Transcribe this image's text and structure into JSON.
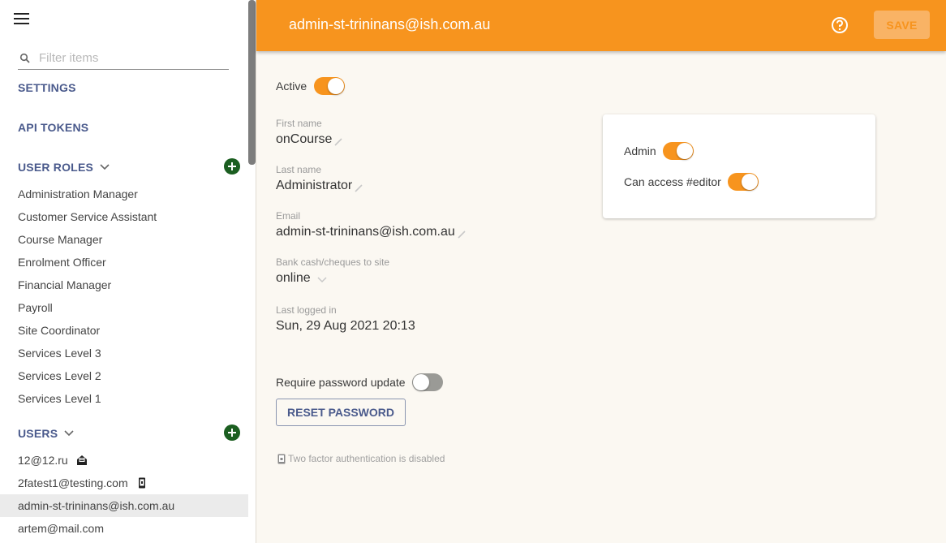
{
  "sidebar": {
    "filter_placeholder": "Filter items",
    "filter_value": "",
    "settings_label": "SETTINGS",
    "api_tokens_label": "API TOKENS",
    "user_roles": {
      "label": "USER ROLES",
      "items": [
        "Administration Manager",
        "Customer Service Assistant",
        "Course Manager",
        "Enrolment Officer",
        "Financial Manager",
        "Payroll",
        "Site Coordinator",
        "Services Level 3",
        "Services Level 2",
        "Services Level 1"
      ]
    },
    "users": {
      "label": "USERS",
      "items": [
        {
          "email": "12@12.ru",
          "icon": "email-otp-icon"
        },
        {
          "email": "2fatest1@testing.com",
          "icon": "phone-2fa-icon"
        },
        {
          "email": "admin-st-trininans@ish.com.au",
          "icon": "",
          "selected": true
        },
        {
          "email": "artem@mail.com",
          "icon": ""
        }
      ]
    }
  },
  "header": {
    "title": "admin-st-trininans@ish.com.au",
    "save_label": "SAVE",
    "accent_color": "#f7941e"
  },
  "form": {
    "active": {
      "label": "Active",
      "value": true
    },
    "first_name": {
      "label": "First name",
      "value": "onCourse"
    },
    "last_name": {
      "label": "Last name",
      "value": "Administrator"
    },
    "email": {
      "label": "Email",
      "value": "admin-st-trininans@ish.com.au"
    },
    "bank": {
      "label": "Bank cash/cheques to site",
      "value": "online"
    },
    "last_logged": {
      "label": "Last logged in",
      "value": "Sun, 29 Aug 2021 20:13"
    },
    "require_password": {
      "label": "Require password update",
      "value": false
    },
    "reset_password_label": "RESET PASSWORD",
    "twofa_text": "Two factor authentication is disabled"
  },
  "permissions": {
    "admin": {
      "label": "Admin",
      "value": true
    },
    "editor": {
      "label": "Can access #editor",
      "value": true
    }
  }
}
